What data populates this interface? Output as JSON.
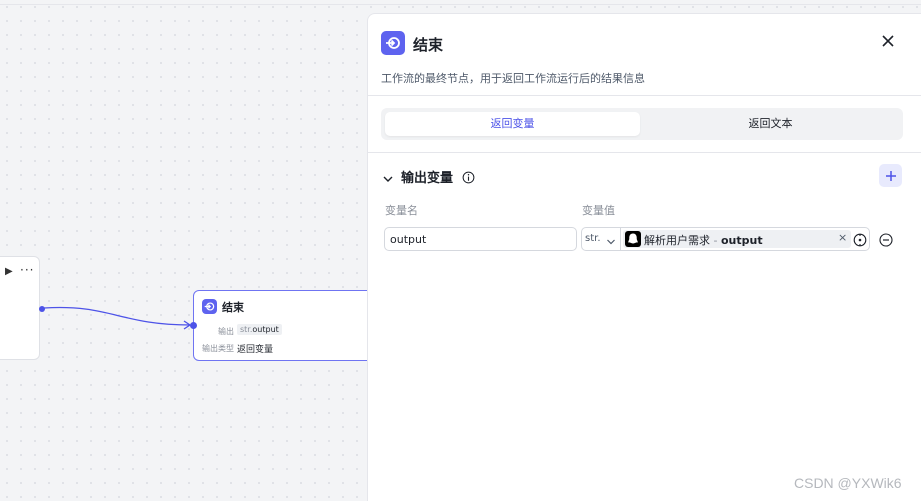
{
  "canvas": {
    "prev_node": {
      "play_icon": "play-icon",
      "more_icon": "more-icon"
    },
    "end_node": {
      "title": "结束",
      "output_label": "输出",
      "output_type": "str.",
      "output_value": "output",
      "output_type_label": "输出类型",
      "output_type_value": "返回变量"
    }
  },
  "panel": {
    "title": "结束",
    "description": "工作流的最终节点，用于返回工作流运行后的结果信息",
    "tabs": [
      {
        "label": "返回变量",
        "active": true
      },
      {
        "label": "返回文本",
        "active": false
      }
    ],
    "section": {
      "title": "输出变量",
      "col_name": "变量名",
      "col_value": "变量值",
      "rows": [
        {
          "name": "output",
          "type": "str.",
          "ref_node": "解析用户需求",
          "ref_sep": " - ",
          "ref_var": "output",
          "clear": "×"
        }
      ]
    }
  },
  "watermark": "CSDN @YXWik6",
  "colors": {
    "accent": "#4d53e8",
    "icon_bg": "#5e63ef"
  }
}
